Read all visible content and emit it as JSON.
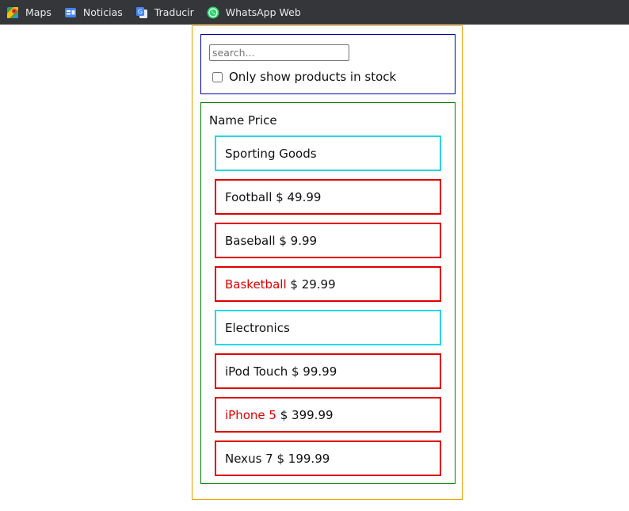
{
  "bookmarks": [
    {
      "label": "Maps",
      "icon": "maps-icon"
    },
    {
      "label": "Noticias",
      "icon": "news-icon"
    },
    {
      "label": "Traducir",
      "icon": "translate-icon"
    },
    {
      "label": "WhatsApp Web",
      "icon": "whatsapp-icon"
    }
  ],
  "search": {
    "placeholder": "search...",
    "value": "",
    "stock_label": "Only show products in stock",
    "stock_checked": false
  },
  "table": {
    "header": "Name Price",
    "rows": [
      {
        "type": "category",
        "label": "Sporting Goods"
      },
      {
        "type": "product",
        "name": "Football",
        "price": "$ 49.99",
        "stocked": true
      },
      {
        "type": "product",
        "name": "Baseball",
        "price": "$ 9.99",
        "stocked": true
      },
      {
        "type": "product",
        "name": "Basketball",
        "price": "$ 29.99",
        "stocked": false
      },
      {
        "type": "category",
        "label": "Electronics"
      },
      {
        "type": "product",
        "name": "iPod Touch",
        "price": "$ 99.99",
        "stocked": true
      },
      {
        "type": "product",
        "name": "iPhone 5",
        "price": "$ 399.99",
        "stocked": false
      },
      {
        "type": "product",
        "name": "Nexus 7",
        "price": "$ 199.99",
        "stocked": true
      }
    ]
  },
  "colors": {
    "bookmarks_bg": "#35363a",
    "app_border": "#f0a000",
    "search_border": "#0000aa",
    "table_border": "#008000",
    "category_border": "#26d6e6",
    "product_border": "#e00000",
    "out_of_stock_text": "#e00000"
  }
}
